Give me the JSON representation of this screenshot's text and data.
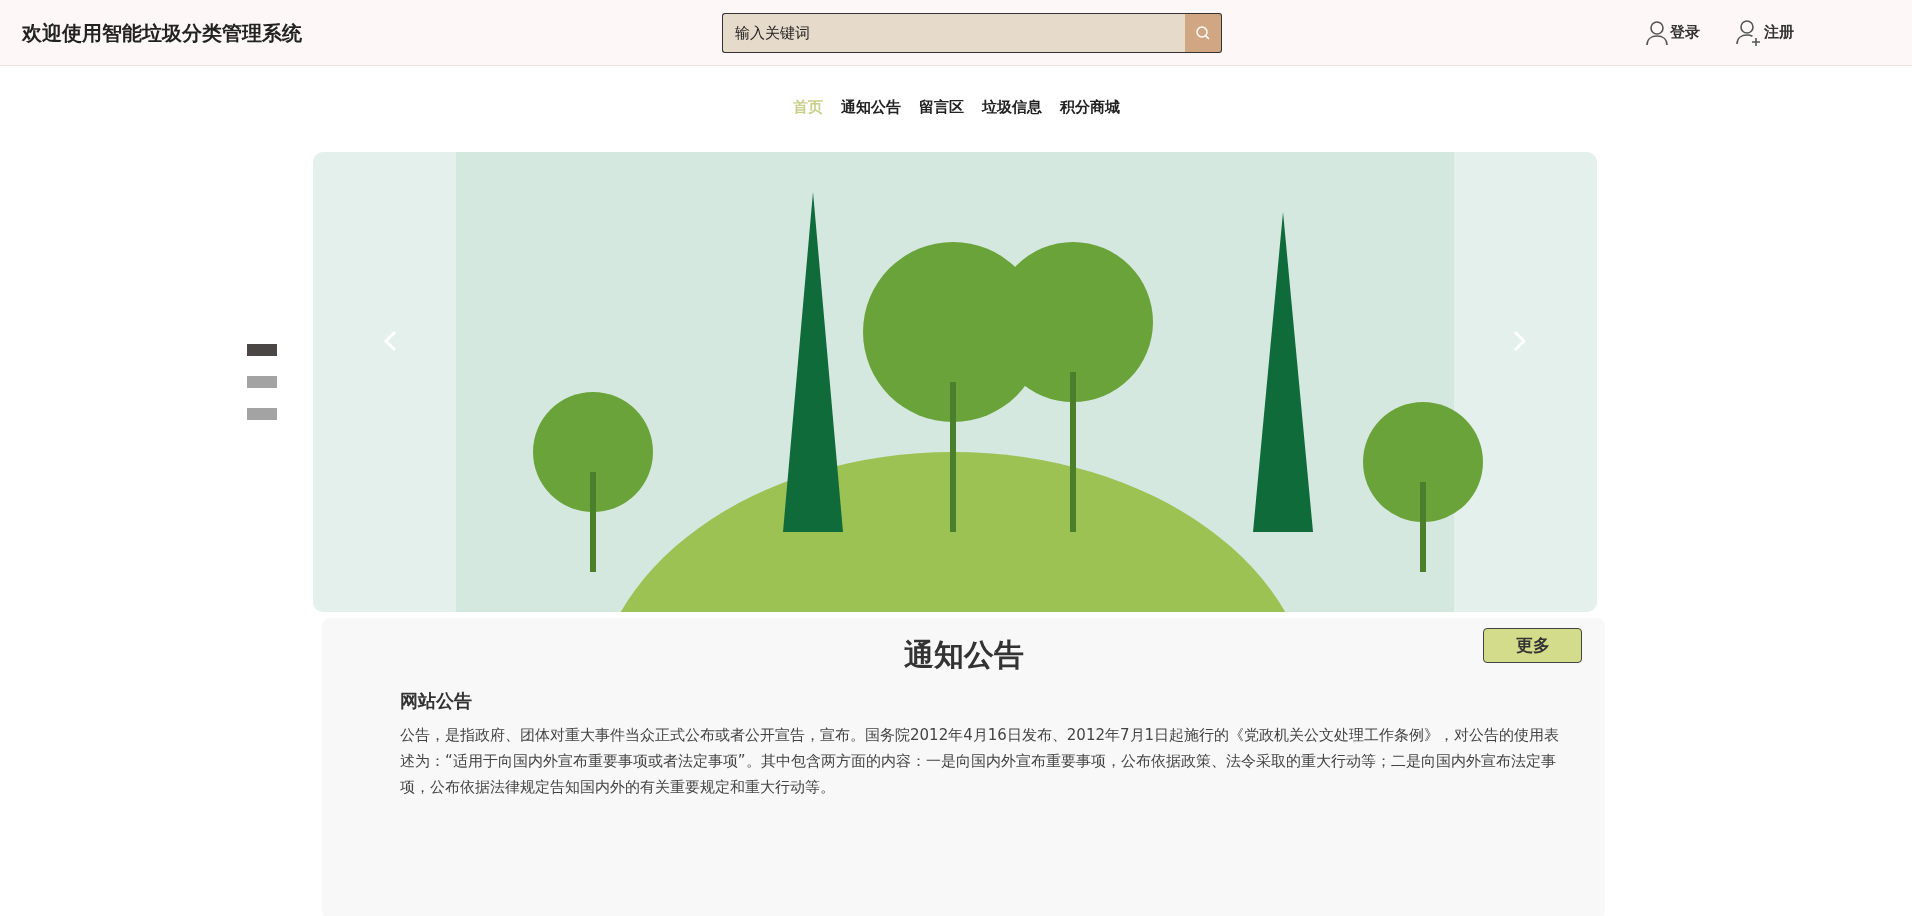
{
  "header": {
    "title": "欢迎使用智能垃圾分类管理系统",
    "search": {
      "placeholder": "输入关键词"
    },
    "links": [
      {
        "kind": "login",
        "label": "登录"
      },
      {
        "kind": "register",
        "label": "注册"
      }
    ]
  },
  "nav": [
    {
      "label": "首页",
      "selected": true
    },
    {
      "label": "通知公告",
      "selected": false
    },
    {
      "label": "留言区",
      "selected": false
    },
    {
      "label": "垃圾信息",
      "selected": false
    },
    {
      "label": "积分商城",
      "selected": false
    }
  ],
  "carousel": {
    "indicators": [
      {
        "selected": true
      },
      {
        "selected": false
      },
      {
        "selected": false
      }
    ]
  },
  "notice": {
    "title": "通知公告",
    "more_button": "更多",
    "heading": "网站公告",
    "body": "公告，是指政府、团体对重大事件当众正式公布或者公开宣告，宣布。国务院2012年4月16日发布、2012年7月1日起施行的《党政机关公文处理工作条例》，对公告的使用表述为：“适用于向国内外宣布重要事项或者法定事项”。其中包含两方面的内容：一是向国内外宣布重要事项，公布依据政策、法令采取的重大行动等；二是向国内外宣布法定事项，公布依据法律规定告知国内外的有关重要规定和重大行动等。"
  }
}
